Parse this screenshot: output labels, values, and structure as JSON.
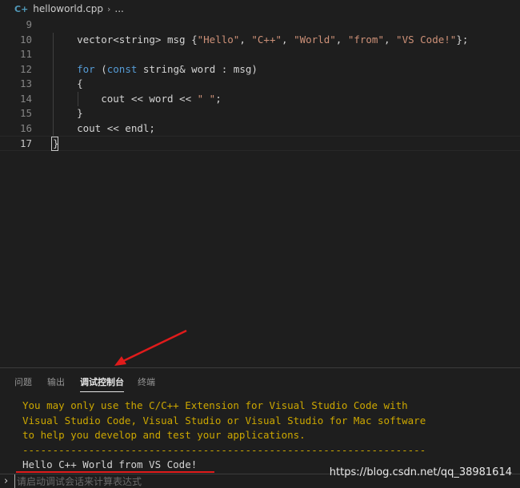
{
  "breadcrumb": {
    "file_icon": "cpp-file-icon",
    "file_name": "helloworld.cpp",
    "separator": "›",
    "more": "..."
  },
  "editor": {
    "lines": [
      {
        "num": "9",
        "text": ""
      },
      {
        "num": "10",
        "text": "    vector<string> msg {\"Hello\", \"C++\", \"World\", \"from\", \"VS Code!\"};"
      },
      {
        "num": "11",
        "text": ""
      },
      {
        "num": "12",
        "text": "    for (const string& word : msg)"
      },
      {
        "num": "13",
        "text": "    {"
      },
      {
        "num": "14",
        "text": "        cout << word << \" \";"
      },
      {
        "num": "15",
        "text": "    }"
      },
      {
        "num": "16",
        "text": "    cout << endl;"
      },
      {
        "num": "17",
        "text": "}"
      }
    ],
    "current_line": "17"
  },
  "panel": {
    "tabs": [
      {
        "label": "问题",
        "active": false
      },
      {
        "label": "输出",
        "active": false
      },
      {
        "label": "调试控制台",
        "active": true
      },
      {
        "label": "终端",
        "active": false
      }
    ]
  },
  "console": {
    "warning_lines": [
      "You may only use the C/C++ Extension for Visual Studio Code with",
      "Visual Studio Code, Visual Studio or Visual Studio for Mac software",
      "to help you develop and test your applications.",
      "-------------------------------------------------------------------"
    ],
    "output_line": "Hello C++ World from VS Code!",
    "input_placeholder": "请启动调试会话来计算表达式",
    "prompt_icon": "chevron-right-icon"
  },
  "watermark": "https://blog.csdn.net/qq_38981614",
  "colors": {
    "background": "#1e1e1e",
    "keyword": "#569cd6",
    "string": "#ce9178",
    "warning": "#cca700",
    "annotation": "#e01b1b"
  }
}
